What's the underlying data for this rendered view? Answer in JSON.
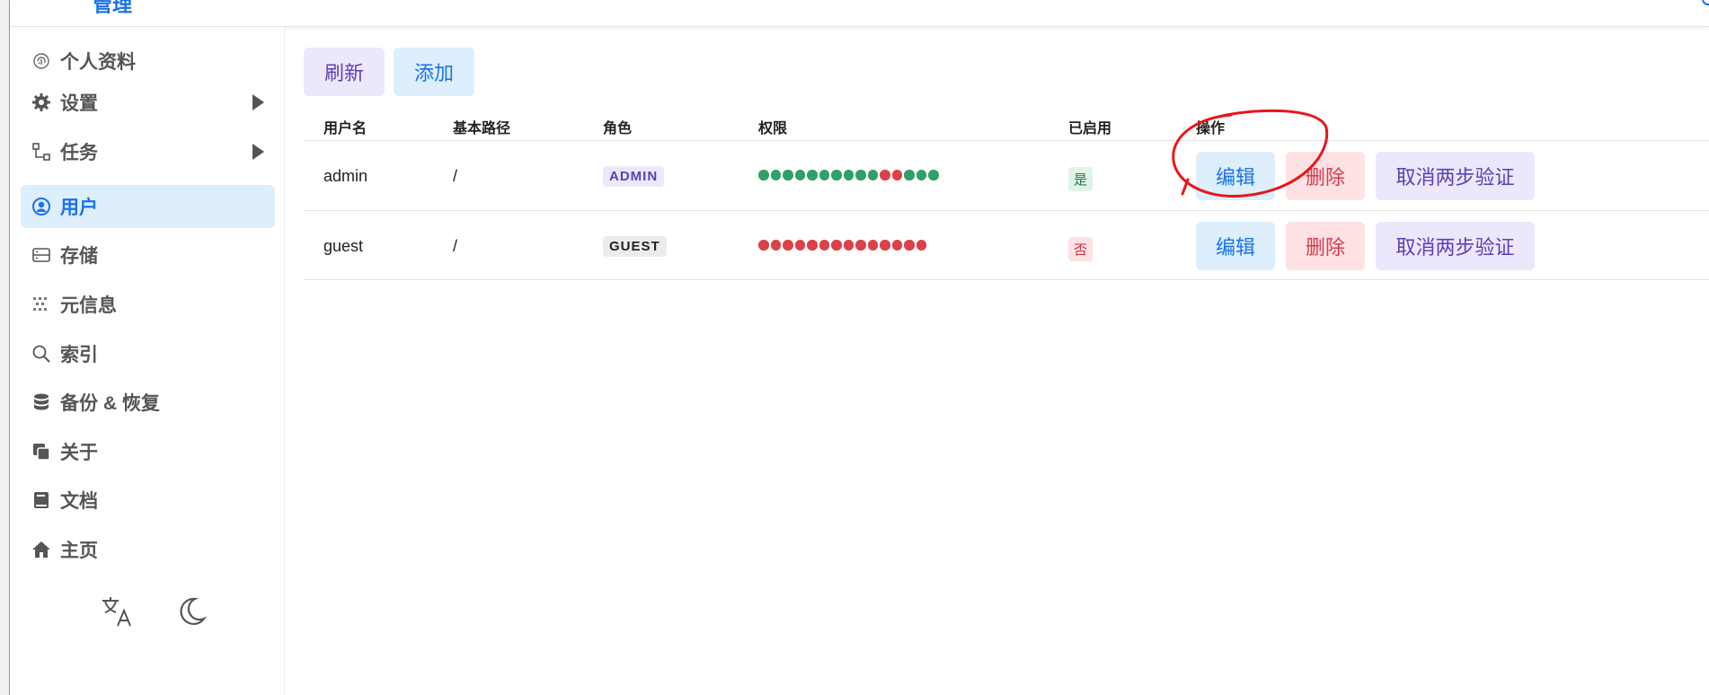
{
  "topbar": {
    "logo_text": "管理"
  },
  "sidebar": {
    "items": [
      {
        "label": "个人资料",
        "icon": "fingerprint-icon"
      },
      {
        "label": "设置",
        "icon": "gear-icon",
        "expandable": true
      },
      {
        "label": "任务",
        "icon": "workflow-icon",
        "expandable": true
      },
      {
        "label": "用户",
        "icon": "user-circle-icon",
        "active": true
      },
      {
        "label": "存储",
        "icon": "storage-icon"
      },
      {
        "label": "元信息",
        "icon": "metadata-icon"
      },
      {
        "label": "索引",
        "icon": "search-icon"
      },
      {
        "label": "备份 & 恢复",
        "icon": "database-icon"
      },
      {
        "label": "关于",
        "icon": "copy-icon"
      },
      {
        "label": "文档",
        "icon": "book-icon"
      },
      {
        "label": "主页",
        "icon": "home-icon"
      }
    ],
    "bottom": {
      "translate_icon": "translate-icon",
      "theme_icon": "moon-icon"
    }
  },
  "toolbar": {
    "refresh_label": "刷新",
    "add_label": "添加"
  },
  "table": {
    "headers": [
      "用户名",
      "基本路径",
      "角色",
      "权限",
      "已启用",
      "操作"
    ],
    "rows": [
      {
        "username": "admin",
        "base_path": "/",
        "role": "ADMIN",
        "permissions": [
          1,
          1,
          1,
          1,
          1,
          1,
          1,
          1,
          1,
          1,
          0,
          0,
          1,
          1,
          1
        ],
        "enabled": "是",
        "actions": {
          "edit": "编辑",
          "delete": "删除",
          "cancel_2fa": "取消两步验证"
        }
      },
      {
        "username": "guest",
        "base_path": "/",
        "role": "GUEST",
        "permissions": [
          0,
          0,
          0,
          0,
          0,
          0,
          0,
          0,
          0,
          0,
          0,
          0,
          0,
          0
        ],
        "enabled": "否",
        "actions": {
          "edit": "编辑",
          "delete": "删除",
          "cancel_2fa": "取消两步验证"
        }
      }
    ]
  },
  "colors": {
    "accent": "#1a73e8",
    "permission_on": "#2ea06a",
    "permission_off": "#dc4049",
    "annotation": "#e8161c"
  }
}
